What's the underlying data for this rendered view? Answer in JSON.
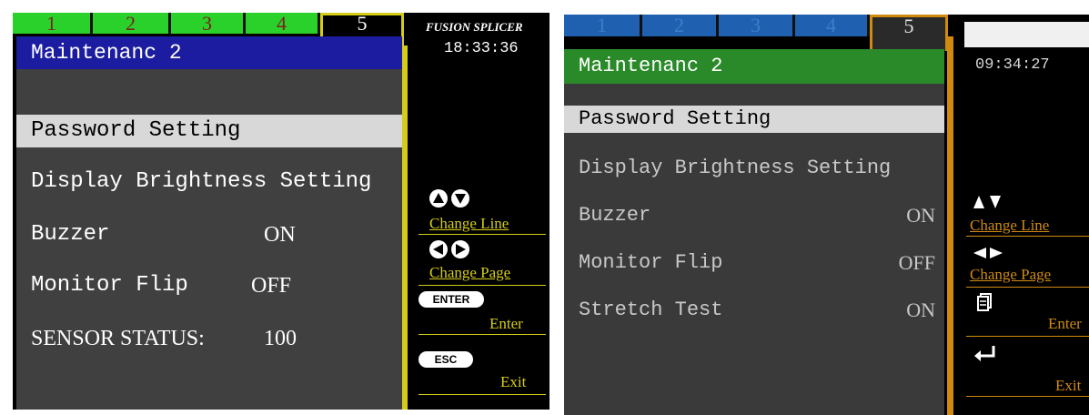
{
  "left_screen": {
    "tabs": [
      "1",
      "2",
      "3",
      "4",
      "5"
    ],
    "active_tab": "5",
    "title": "Maintenanc 2",
    "brand": "FUSION SPLICER",
    "clock": "18:33:36",
    "menu": [
      {
        "label": "Password Setting",
        "value": "",
        "selected": true
      },
      {
        "label": "Display Brightness Setting",
        "value": "",
        "selected": false
      },
      {
        "label": "Buzzer",
        "value": "ON",
        "selected": false
      },
      {
        "label": "Monitor Flip",
        "value": "OFF",
        "selected": false
      },
      {
        "label": "SENSOR STATUS:",
        "value": "100",
        "selected": false
      }
    ],
    "hints": {
      "change_line": "Change Line",
      "change_page": "Change Page",
      "enter_key": "ENTER",
      "enter": "Enter",
      "esc_key": "ESC",
      "exit": "Exit"
    },
    "colors": {
      "tab": "#2ad12a",
      "title_bar": "#1c1ca0",
      "accent": "#d4cc18"
    }
  },
  "right_screen": {
    "tabs": [
      "1",
      "2",
      "3",
      "4",
      "5"
    ],
    "active_tab": "5",
    "title": "Maintenanc 2",
    "clock": "09:34:27",
    "menu": [
      {
        "label": "Password Setting",
        "value": "",
        "selected": true
      },
      {
        "label": "Display Brightness Setting",
        "value": "",
        "selected": false
      },
      {
        "label": "Buzzer",
        "value": "ON",
        "selected": false
      },
      {
        "label": "Monitor Flip",
        "value": "OFF",
        "selected": false
      },
      {
        "label": "Stretch Test",
        "value": "ON",
        "selected": false
      }
    ],
    "hints": {
      "change_line": "Change Line",
      "change_page": "Change Page",
      "enter": "Enter",
      "exit": "Exit"
    },
    "colors": {
      "tab": "#2060b0",
      "title_bar": "#2a8a2a",
      "accent": "#d08a10"
    }
  }
}
